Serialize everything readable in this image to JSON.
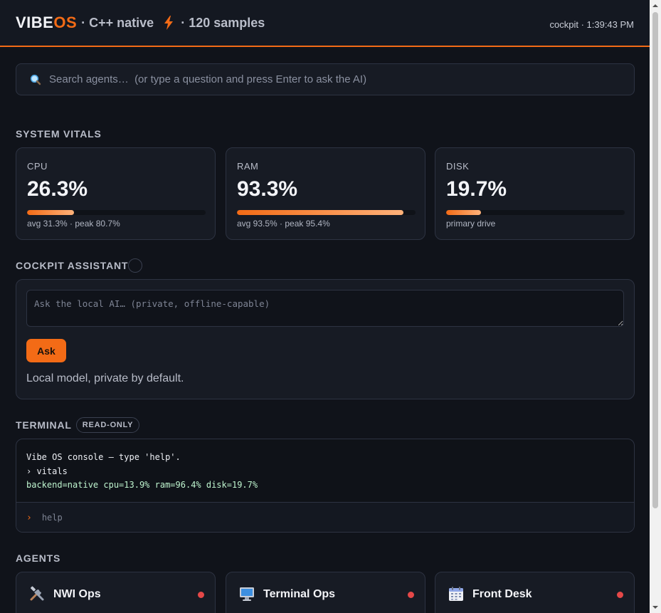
{
  "header": {
    "brand_vibe": "VIBE",
    "brand_os": "OS",
    "brand_meta": "· C++ native",
    "brand_samples": "· 120 samples",
    "right": "cockpit · 1:39:43 PM",
    "accent": "#f36b16"
  },
  "search": {
    "placeholder": "Search agents…  (or type a question and press Enter to ask the AI)",
    "icon": "magnifier-icon"
  },
  "vitals": {
    "title": "SYSTEM VITALS",
    "cards": [
      {
        "label": "CPU",
        "value": "26.3%",
        "fraction": 0.263,
        "sub": "avg 31.3% · peak 80.7%"
      },
      {
        "label": "RAM",
        "value": "93.3%",
        "fraction": 0.933,
        "sub": "avg 93.5% · peak 95.4%"
      },
      {
        "label": "DISK",
        "value": "19.7%",
        "fraction": 0.197,
        "sub": "primary drive"
      }
    ]
  },
  "assistant": {
    "title": "COCKPIT ASSISTANT",
    "placeholder": "Ask the local AI… (private, offline-capable)",
    "button": "Ask",
    "note": "Local model, private by default."
  },
  "terminal": {
    "title": "TERMINAL",
    "badge": "READ-ONLY",
    "lines": [
      "Vibe OS console — type 'help'.",
      "› vitals",
      "backend=native cpu=13.9% ram=96.4% disk=19.7%"
    ],
    "prompt": "›",
    "input_placeholder": "help"
  },
  "agents": {
    "title": "AGENTS",
    "items": [
      {
        "name": "NWI Ops",
        "icon": "tools-icon",
        "status_color": "#e54848"
      },
      {
        "name": "Terminal Ops",
        "icon": "monitor-icon",
        "status_color": "#e54848"
      },
      {
        "name": "Front Desk",
        "icon": "calendar-icon",
        "status_color": "#e54848"
      }
    ]
  }
}
